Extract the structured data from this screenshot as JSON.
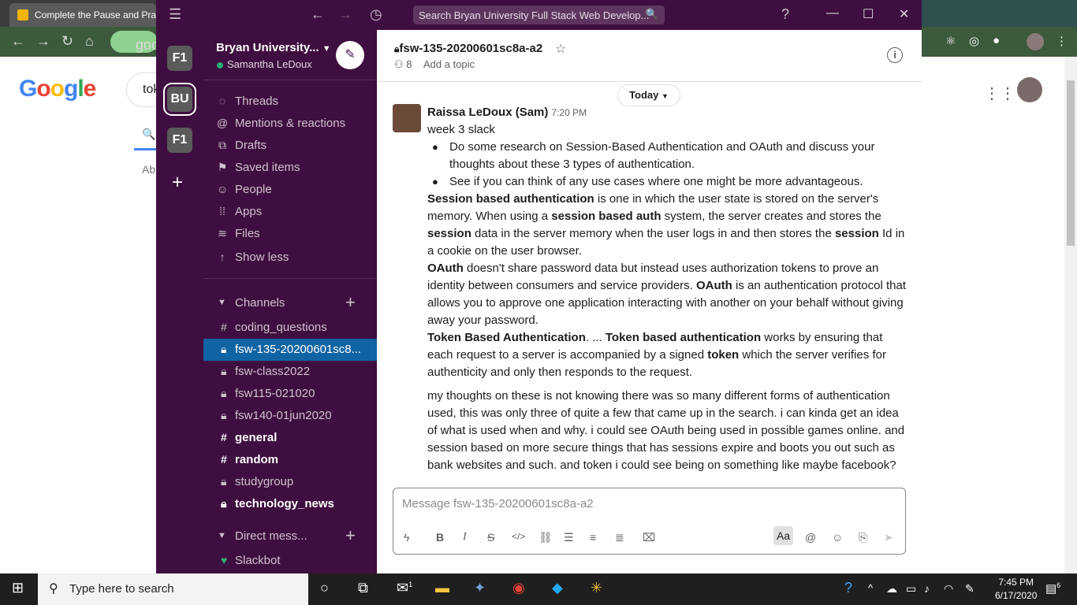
{
  "browser": {
    "tab_title": "Complete the Pause and Prac",
    "address": "goo",
    "search_partial": "tok",
    "result_partial": "Ab"
  },
  "slack": {
    "search_placeholder": "Search Bryan University Full Stack Web Develop...",
    "workspaces": [
      "F1",
      "BU",
      "F1"
    ],
    "workspace_name": "Bryan University...",
    "user_name": "Samantha LeDoux",
    "nav": [
      {
        "label": "Threads",
        "icon": "threads-icon"
      },
      {
        "label": "Mentions & reactions",
        "icon": "at-icon"
      },
      {
        "label": "Drafts",
        "icon": "drafts-icon"
      },
      {
        "label": "Saved items",
        "icon": "bookmark-icon"
      },
      {
        "label": "People",
        "icon": "people-icon"
      },
      {
        "label": "Apps",
        "icon": "apps-icon"
      },
      {
        "label": "Files",
        "icon": "files-icon"
      },
      {
        "label": "Show less",
        "icon": "arrow-up-icon"
      }
    ],
    "channels_label": "Channels",
    "channels": [
      {
        "name": "coding_questions",
        "prefix": "#",
        "bold": false,
        "active": false
      },
      {
        "name": "fsw-135-20200601sc8...",
        "prefix": "lock",
        "bold": false,
        "active": true
      },
      {
        "name": "fsw-class2022",
        "prefix": "lock",
        "bold": false,
        "active": false
      },
      {
        "name": "fsw115-021020",
        "prefix": "lock",
        "bold": false,
        "active": false
      },
      {
        "name": "fsw140-01jun2020",
        "prefix": "lock",
        "bold": false,
        "active": false
      },
      {
        "name": "general",
        "prefix": "#",
        "bold": true,
        "active": false
      },
      {
        "name": "random",
        "prefix": "#",
        "bold": true,
        "active": false
      },
      {
        "name": "studygroup",
        "prefix": "lock",
        "bold": false,
        "active": false
      },
      {
        "name": "technology_news",
        "prefix": "lock",
        "bold": true,
        "active": false
      }
    ],
    "dm_label": "Direct mess...",
    "dms": [
      {
        "name": "Slackbot"
      }
    ],
    "channel": {
      "name": "fsw-135-20200601sc8a-a2",
      "members": "8",
      "topic": "Add a topic",
      "date_divider": "Today"
    },
    "message": {
      "sender": "Raissa LeDoux (Sam)",
      "time": "7:20 PM",
      "line1": "week 3 slack",
      "bullet1": "Do some research on Session-Based Authentication and OAuth and discuss your thoughts about these 3 types of authentication.",
      "bullet2": "See if you can think of any use cases where one might be more advantageous.",
      "s1_b1": "Session based authentication",
      "s1_t1": " is one in which the user state is stored on the server's memory. When using a ",
      "s1_b2": "session based auth",
      "s1_t2": " system, the server creates and stores the ",
      "s1_b3": "session",
      "s1_t3": " data in the server memory when the user logs in and then stores the ",
      "s1_b4": "session",
      "s1_t4": " Id in a cookie on the user browser.",
      "s2_b1": "OAuth",
      "s2_t1": " doesn't share password data but instead uses authorization tokens to prove an identity between consumers and service providers. ",
      "s2_b2": "OAuth",
      "s2_t2": " is an authentication protocol that allows you to approve one application interacting with another on your behalf without giving away your password.",
      "s3_b1": "Token Based Authentication",
      "s3_t1": ". ... ",
      "s3_b2": "Token based authentication",
      "s3_t2": " works by ensuring that each request to a server is accompanied by a signed ",
      "s3_b3": "token",
      "s3_t3": " which the server verifies for authenticity and only then responds to the request.",
      "thoughts": "my thoughts on these is not knowing there was so many different forms of authentication used, this was only three of quite a few that came up in the search. i can kinda get an idea of what is used when and why. i could see OAuth being used in possible games online.  and session based on more secure things that has sessions expire and boots you out such as bank websites and such. and token i could see being on something like maybe facebook?"
    },
    "composer": {
      "placeholder": "Message fsw-135-20200601sc8a-a2",
      "aa_label": "Aa"
    }
  },
  "taskbar": {
    "search_placeholder": "Type here to search",
    "time": "7:45 PM",
    "date": "6/17/2020",
    "mail_badge": "1",
    "notif_badge": "6"
  },
  "colors": {
    "aubergine": "#3f0e40",
    "active_channel": "#1164a3",
    "presence": "#2bac76"
  }
}
